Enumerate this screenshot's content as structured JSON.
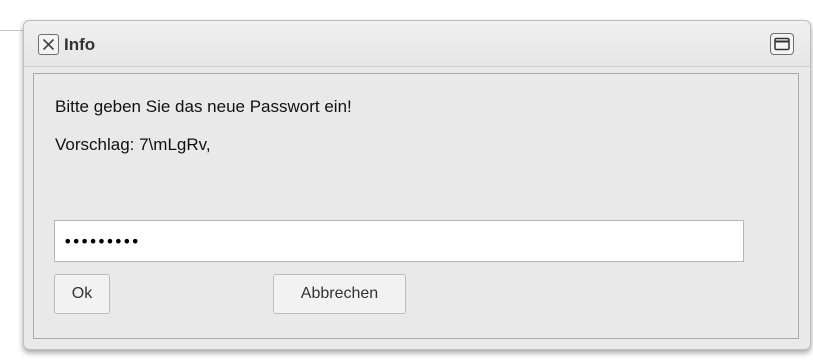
{
  "dialog": {
    "title": "Info",
    "close_icon": "close-x-icon",
    "maximize_icon": "maximize-window-icon"
  },
  "content": {
    "message": "Bitte geben Sie das neue Passwort ein!",
    "suggestion": "Vorschlag: 7\\mLgRv,"
  },
  "password_field": {
    "value": "7\\mLgRv,Q",
    "masked_display": "•••••••••"
  },
  "buttons": {
    "ok_label": "Ok",
    "cancel_label": "Abbrechen"
  }
}
